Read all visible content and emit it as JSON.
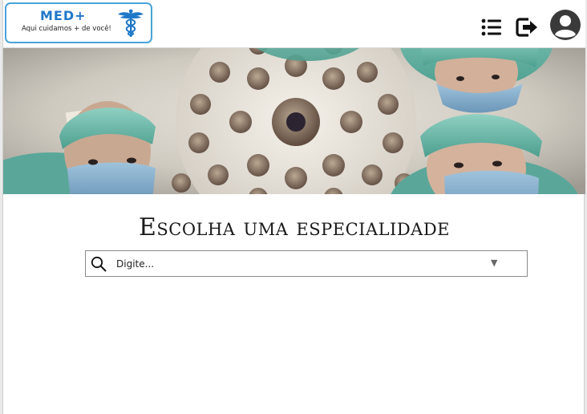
{
  "header": {
    "logo": {
      "title": "MED+",
      "tagline": "Aqui cuidamos + de você!",
      "icon": "caduceus-icon"
    },
    "actions": [
      {
        "icon": "menu-list-icon"
      },
      {
        "icon": "logout-icon"
      },
      {
        "icon": "user-avatar-icon"
      }
    ]
  },
  "hero": {
    "image": "surgeons-looking-down-under-operating-lamp"
  },
  "main": {
    "title": "Escolha uma especialidade",
    "search": {
      "placeholder": "Digite...",
      "value": "",
      "dropdown_icon": "chevron-down-icon"
    }
  },
  "colors": {
    "brand_blue": "#1f78c8",
    "logo_border": "#4aa3d9",
    "text": "#1a1a1a",
    "scrub_teal": "#5fb3a3"
  }
}
